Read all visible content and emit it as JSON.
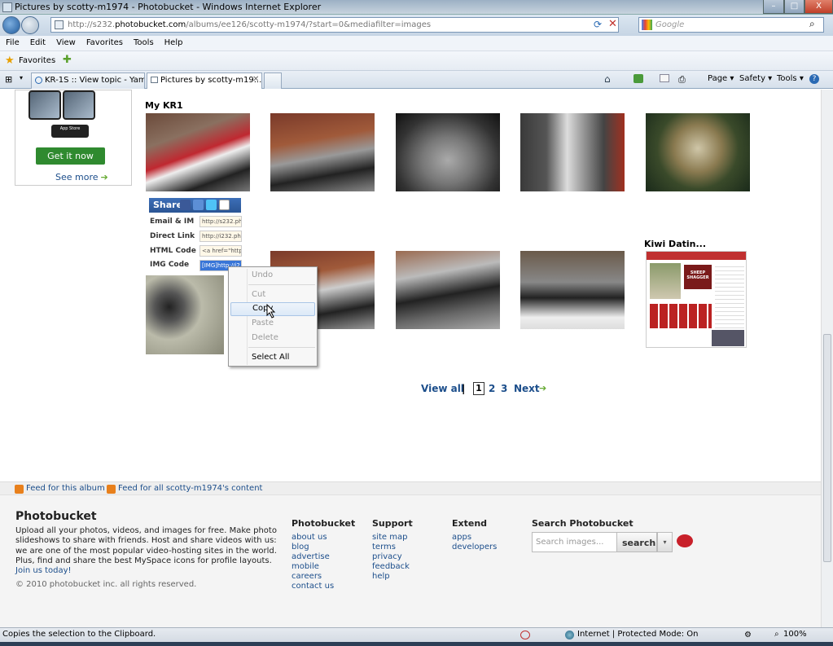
{
  "window": {
    "title": "Pictures by scotty-m1974 - Photobucket - Windows Internet Explorer",
    "min": "–",
    "max": "□",
    "close": "X"
  },
  "address": {
    "url_prefix": "http://s232.",
    "url_domain": "photobucket.com",
    "url_rest": "/albums/ee126/scotty-m1974/?start=0&mediafilter=images",
    "search_placeholder": "Google"
  },
  "menu": [
    "File",
    "Edit",
    "View",
    "Favorites",
    "Tools",
    "Help"
  ],
  "favorites": {
    "label": "Favorites"
  },
  "tabs": [
    {
      "label": "KR-1S :: View topic - Yama..."
    },
    {
      "label": "Pictures by scotty-m19..."
    }
  ],
  "toolbar": {
    "page": "Page ▾",
    "safety": "Safety ▾",
    "tools": "Tools ▾"
  },
  "ad": {
    "cta": "Get it now",
    "see_more": "See more",
    "store": "App Store"
  },
  "album": {
    "title": "My KR1"
  },
  "share": {
    "label": "Share",
    "rows": [
      {
        "label": "Email & IM",
        "value": "http://s232.ph"
      },
      {
        "label": "Direct Link",
        "value": "http://i232.ph"
      },
      {
        "label": "HTML Code",
        "value": "<a href=\"http"
      },
      {
        "label": "IMG Code",
        "value": "[IMG]http://i2"
      }
    ]
  },
  "context_menu": {
    "undo": "Undo",
    "cut": "Cut",
    "copy": "Copy",
    "paste": "Paste",
    "delete": "Delete",
    "select_all": "Select All"
  },
  "sponsor": {
    "title": "Kiwi Datin...",
    "headline": "SHEEP SHAGGER"
  },
  "pagination": {
    "view_all": "View all",
    "sep": "|",
    "current": "1",
    "p2": "2",
    "p3": "3",
    "next": "Next"
  },
  "feeds": {
    "album": "Feed for this album",
    "user": "Feed for all scotty-m1974's content"
  },
  "footer": {
    "brand": "Photobucket",
    "description": "Upload all your photos, videos, and images for free. Make photo slideshows to share with friends. Host and share videos with us: we are one of the most popular video-hosting sites in the world. Plus, find and share the best MySpace icons for profile layouts.",
    "join": "Join us today!",
    "copyright": "© 2010 photobucket inc. all rights reserved.",
    "col1": {
      "title": "Photobucket",
      "links": [
        "about us",
        "blog",
        "advertise",
        "mobile",
        "careers",
        "contact us"
      ]
    },
    "col2": {
      "title": "Support",
      "links": [
        "site map",
        "terms",
        "privacy",
        "feedback",
        "help"
      ]
    },
    "col3": {
      "title": "Extend",
      "links": [
        "apps",
        "developers"
      ]
    },
    "search": {
      "title": "Search Photobucket",
      "placeholder": "Search images...",
      "button": "search"
    }
  },
  "status": {
    "message": "Copies the selection to the Clipboard.",
    "zone": "Internet | Protected Mode: On",
    "zoom": "100%"
  },
  "colors": {
    "link": "#1c4e8b",
    "share_bar": "#3d6fb8",
    "get_it": "#2f8a2f"
  }
}
